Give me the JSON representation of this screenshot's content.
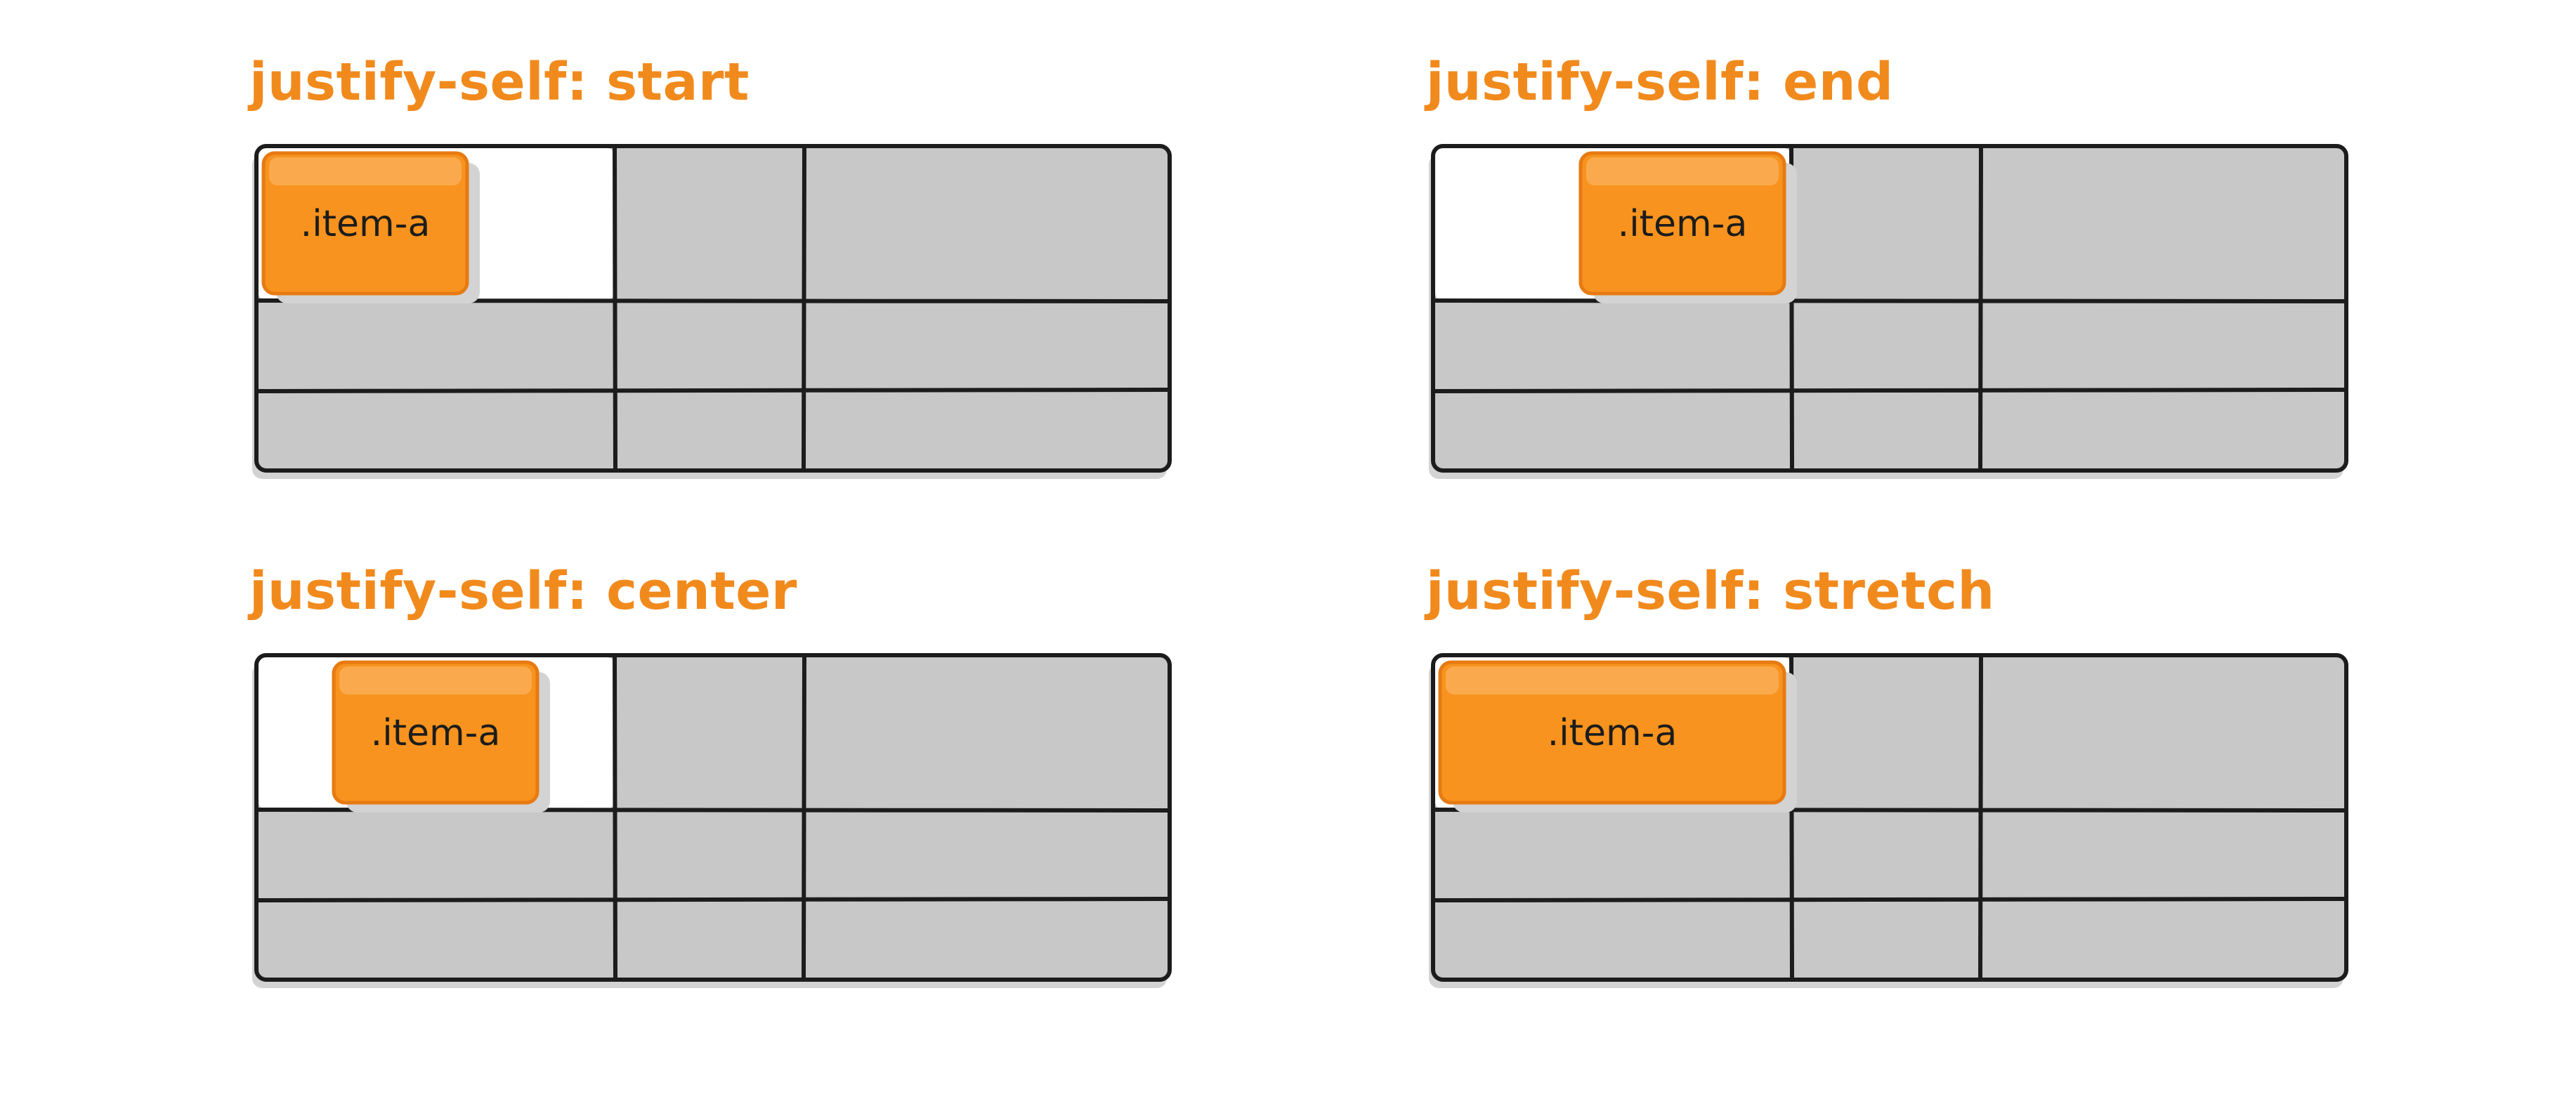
{
  "panels": [
    {
      "id": "start",
      "title": "justify-self: start",
      "align": "start",
      "item_label": ".item-a"
    },
    {
      "id": "end",
      "title": "justify-self: end",
      "align": "end",
      "item_label": ".item-a"
    },
    {
      "id": "center",
      "title": "justify-self: center",
      "align": "center",
      "item_label": ".item-a"
    },
    {
      "id": "stretch",
      "title": "justify-self: stretch",
      "align": "stretch",
      "item_label": ".item-a"
    }
  ],
  "colors": {
    "title": "#f18a1d",
    "item_fill": "#f7931e",
    "item_highlight": "#fbb15c",
    "item_border": "#e77a12",
    "cell_fill": "#c8c8c8",
    "shadow": "#d3d3d3",
    "line": "#1c1c1c",
    "active_cell": "#ffffff"
  }
}
